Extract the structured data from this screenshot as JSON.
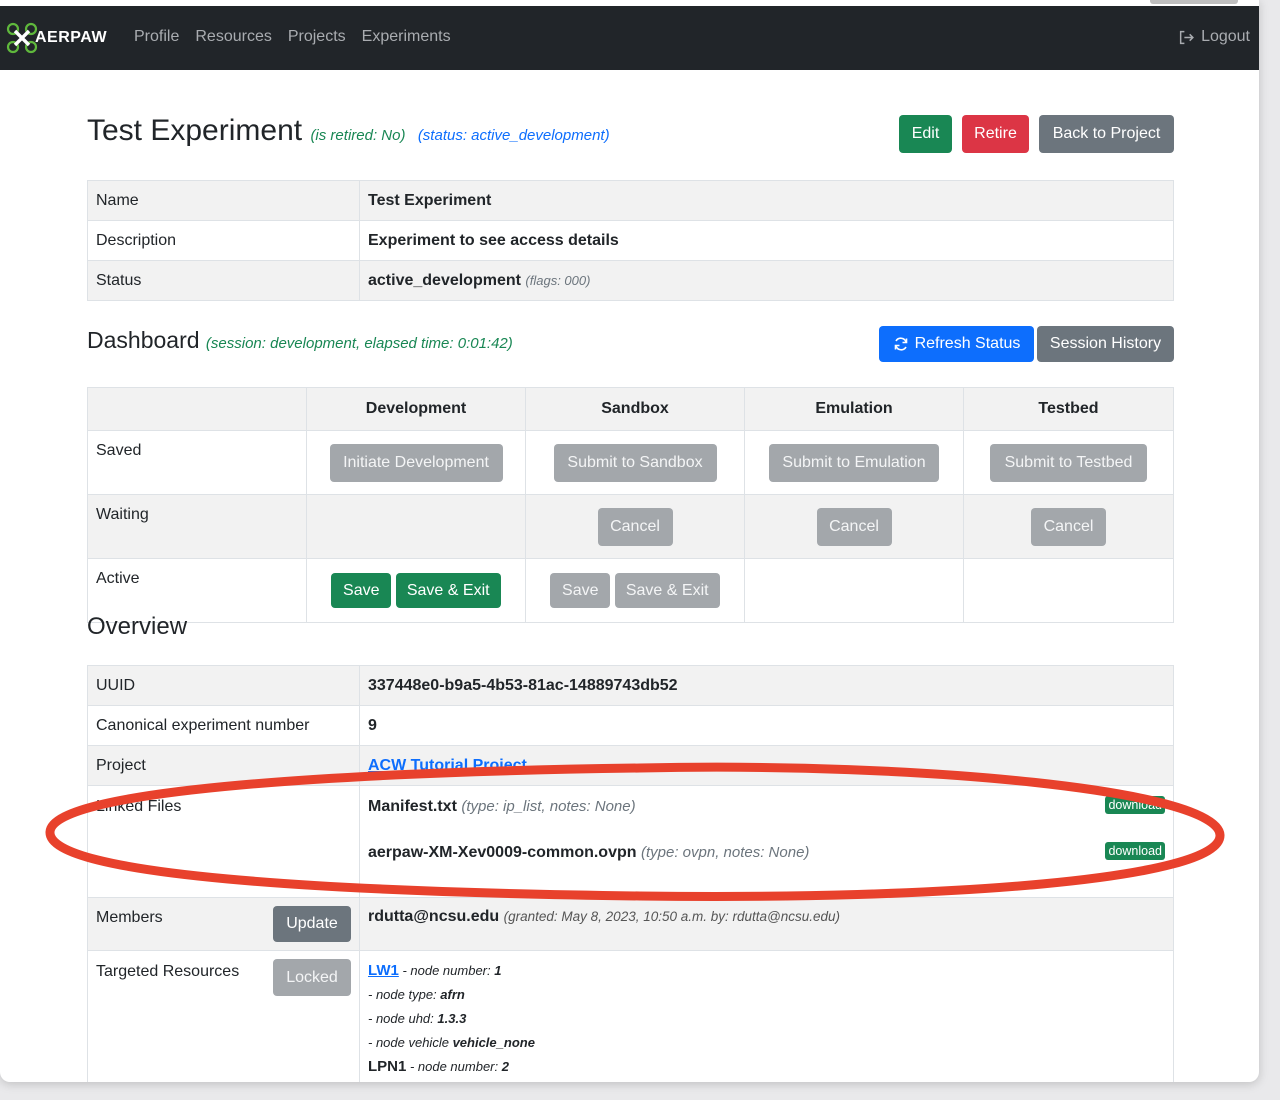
{
  "nav": {
    "brand": "AERPAW",
    "links": [
      "Profile",
      "Resources",
      "Projects",
      "Experiments"
    ],
    "logout": "Logout"
  },
  "header": {
    "title": "Test Experiment",
    "retired": "(is retired: No)",
    "status": "(status: active_development)",
    "buttons": {
      "edit": "Edit",
      "retire": "Retire",
      "back": "Back to Project"
    }
  },
  "details": {
    "name_label": "Name",
    "name_value": "Test Experiment",
    "description_label": "Description",
    "description_value": "Experiment to see access details",
    "status_label": "Status",
    "status_value": "active_development",
    "status_flags": "(flags: 000)"
  },
  "dashboard": {
    "title": "Dashboard",
    "session": "(session: development, elapsed time: 0:01:42)",
    "refresh": "Refresh Status",
    "history": "Session History",
    "columns": [
      "Development",
      "Sandbox",
      "Emulation",
      "Testbed"
    ],
    "rows": {
      "saved": "Saved",
      "waiting": "Waiting",
      "active": "Active"
    },
    "saved_buttons": [
      "Initiate Development",
      "Submit to Sandbox",
      "Submit to Emulation",
      "Submit to Testbed"
    ],
    "cancel": "Cancel",
    "save": "Save",
    "save_exit": "Save & Exit"
  },
  "overview": {
    "title": "Overview",
    "uuid_label": "UUID",
    "uuid_value": "337448e0-b9a5-4b53-81ac-14889743db52",
    "canonical_label": "Canonical experiment number",
    "canonical_value": "9",
    "project_label": "Project",
    "project_value": "ACW Tutorial Project",
    "files_label": "Linked Files",
    "file1_name": "Manifest.txt",
    "file1_note": "(type: ip_list, notes: None)",
    "file2_name": "aerpaw-XM-Xev0009-common.ovpn",
    "file2_note": "(type: ovpn, notes: None)",
    "download": "download",
    "members_label": "Members",
    "members_button": "Update",
    "member_email": "rdutta@ncsu.edu",
    "member_note": "(granted: May 8, 2023, 10:50 a.m. by: rdutta@ncsu.edu)",
    "resources_label": "Targeted Resources",
    "resources_button": "Locked",
    "res1_name": "LW1",
    "res1_number_label": " - node number: ",
    "res1_number": "1",
    "res1_type_label": "- node type: ",
    "res1_type": "afrn",
    "res1_uhd_label": "- node uhd: ",
    "res1_uhd": "1.3.3",
    "res1_vehicle_label": "- node vehicle ",
    "res1_vehicle": "vehicle_none",
    "res2_name": "LPN1",
    "res2_number_label": " - node number: ",
    "res2_number": "2"
  },
  "colors": {
    "annotation": "#e8412c",
    "green": "#198754",
    "red": "#dc3545",
    "blue": "#0d6efd",
    "gray": "#6c757d"
  }
}
